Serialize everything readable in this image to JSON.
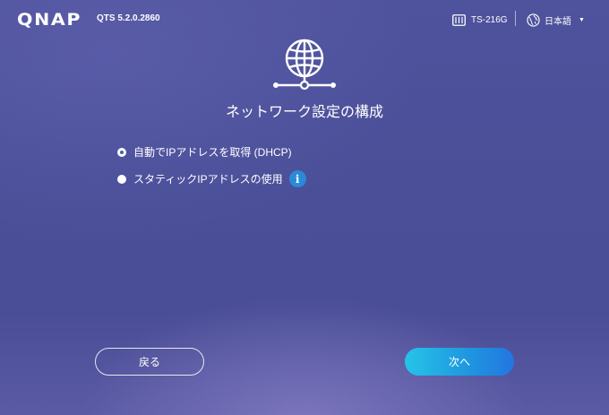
{
  "header": {
    "logo": "QNAP",
    "version": "QTS 5.2.0.2860",
    "model": "TS-216G",
    "model_icon": "nas-device-icon",
    "language": "日本語",
    "language_icon": "globe-icon"
  },
  "main": {
    "hero_icon": "network-globe-icon",
    "title": "ネットワーク設定の構成",
    "options": [
      {
        "label": "自動でIPアドレスを取得 (DHCP)",
        "selected": true
      },
      {
        "label": "スタティックIPアドレスの使用",
        "selected": false,
        "info_icon": "info-icon"
      }
    ]
  },
  "footer": {
    "back_label": "戻る",
    "next_label": "次へ"
  },
  "colors": {
    "accent": "#1f95e0",
    "info": "#2a8ad8"
  }
}
